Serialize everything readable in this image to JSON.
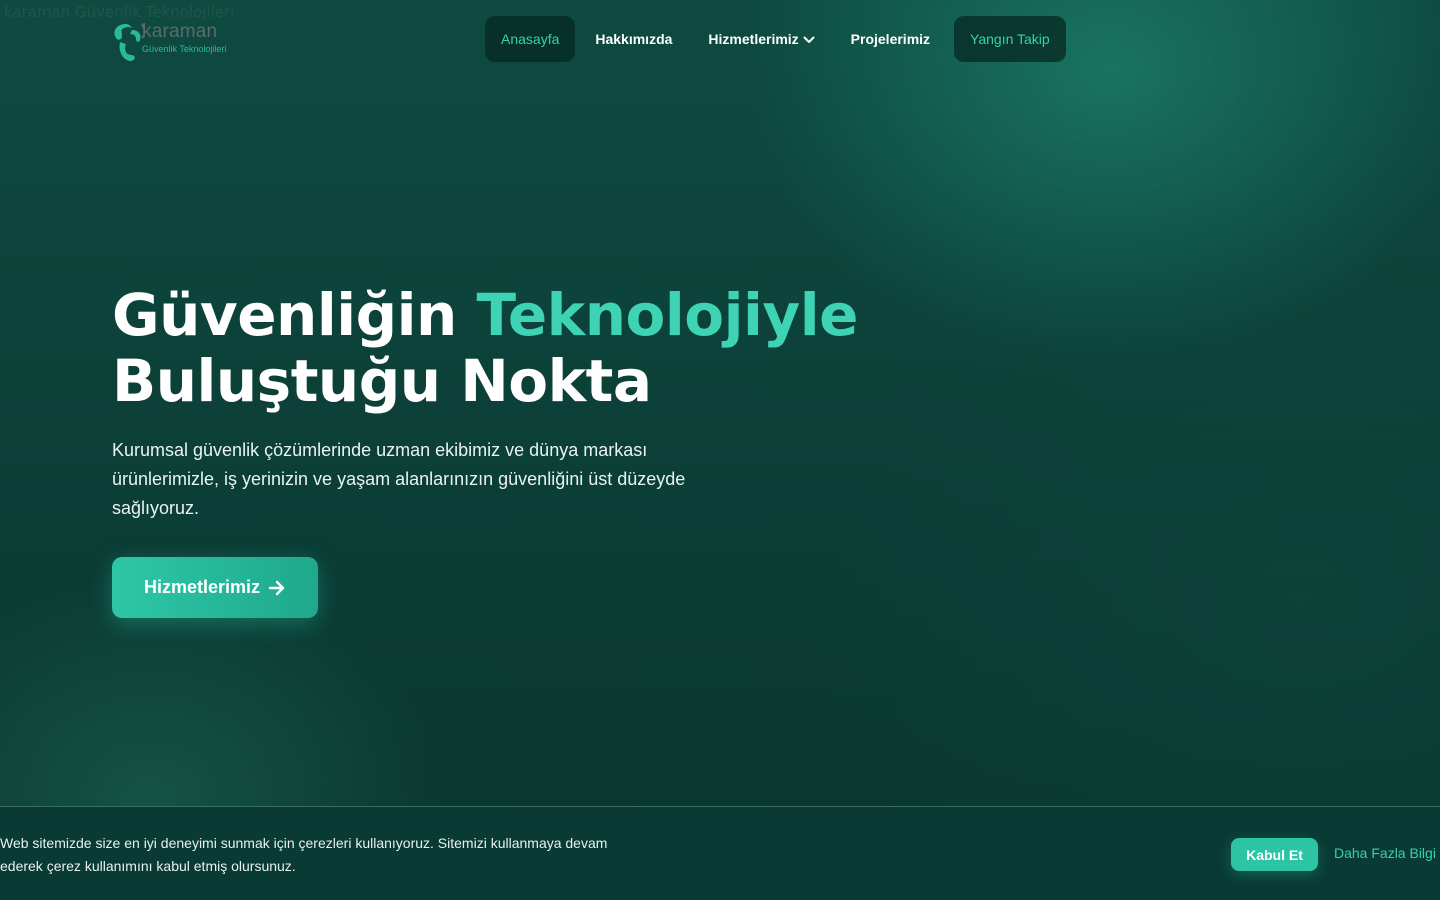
{
  "logo": {
    "alt_text": "karaman Güvenlik Teknolojileri",
    "word": "karaman",
    "tagline": "Güvenlik Teknolojileri"
  },
  "nav": {
    "items": [
      {
        "label": "Anasayfa",
        "active": true
      },
      {
        "label": "Hakkımızda"
      },
      {
        "label": "Hizmetlerimiz",
        "has_dropdown": true
      },
      {
        "label": "Projelerimiz"
      },
      {
        "label": "Yangın Takip",
        "highlight": true
      }
    ]
  },
  "hero": {
    "title_line1_part1": "Güvenliğin ",
    "title_line1_accent": "Teknolojiyle",
    "title_line2": "Buluştuğu Nokta",
    "description": "Kurumsal güvenlik çözümlerinde uzman ekibimiz ve dünya markası ürünlerimizle, iş yerinizin ve yaşam alanlarınızın güvenliğini üst düzeyde sağlıyoruz.",
    "button_label": "Hizmetlerimiz"
  },
  "cookie": {
    "text": "Web sitemizde size en iyi deneyimi sunmak için çerezleri kullanıyoruz. Sitemizi kullanmaya devam ederek çerez kullanımını kabul etmiş olursunuz.",
    "accept_label": "Kabul Et",
    "more_label": "Daha Fazla Bilgi"
  },
  "colors": {
    "accent": "#3dd3b4",
    "background": "#0b3b34",
    "button": "#2cc4a5"
  },
  "icons": {
    "logo": "karaman-logo-swirl-icon",
    "dropdown": "chevron-down-icon",
    "button_arrow": "arrow-right-icon"
  }
}
